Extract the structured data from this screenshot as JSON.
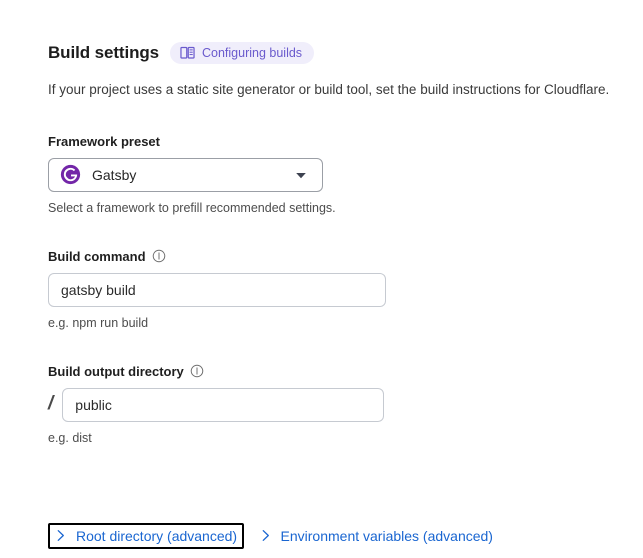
{
  "header": {
    "title": "Build settings",
    "badge": {
      "label": "Configuring builds",
      "icon": "book-icon",
      "bg_color": "#f0eefb",
      "text_color": "#6a5acd"
    },
    "description": "If your project uses a static site generator or build tool, set the build instructions for Cloudflare."
  },
  "framework_preset": {
    "label": "Framework preset",
    "selected_value": "Gatsby",
    "logo": "gatsby-logo",
    "logo_color": "#7326a8",
    "caret_icon": "chevron-down-icon",
    "helper_text": "Select a framework to prefill recommended settings."
  },
  "build_command": {
    "label": "Build command",
    "info_icon": "info-icon",
    "value": "gatsby build",
    "placeholder": "",
    "helper_text": "e.g. npm run build"
  },
  "build_output_directory": {
    "label": "Build output directory",
    "info_icon": "info-icon",
    "prefix": "/",
    "value": "public",
    "placeholder": "",
    "helper_text": "e.g. dist"
  },
  "disclosures": {
    "root_directory": {
      "label": "Root directory (advanced)",
      "icon": "chevron-right-icon",
      "focused": true,
      "expanded": false
    },
    "environment_variables": {
      "label": "Environment variables (advanced)",
      "icon": "chevron-right-icon",
      "focused": false,
      "expanded": false
    }
  },
  "colors": {
    "link": "#1a66d1",
    "accent_purple": "#6a5acd",
    "focus_outline": "#000000",
    "input_border": "#c6cad1",
    "select_border": "#9b9fa6"
  }
}
